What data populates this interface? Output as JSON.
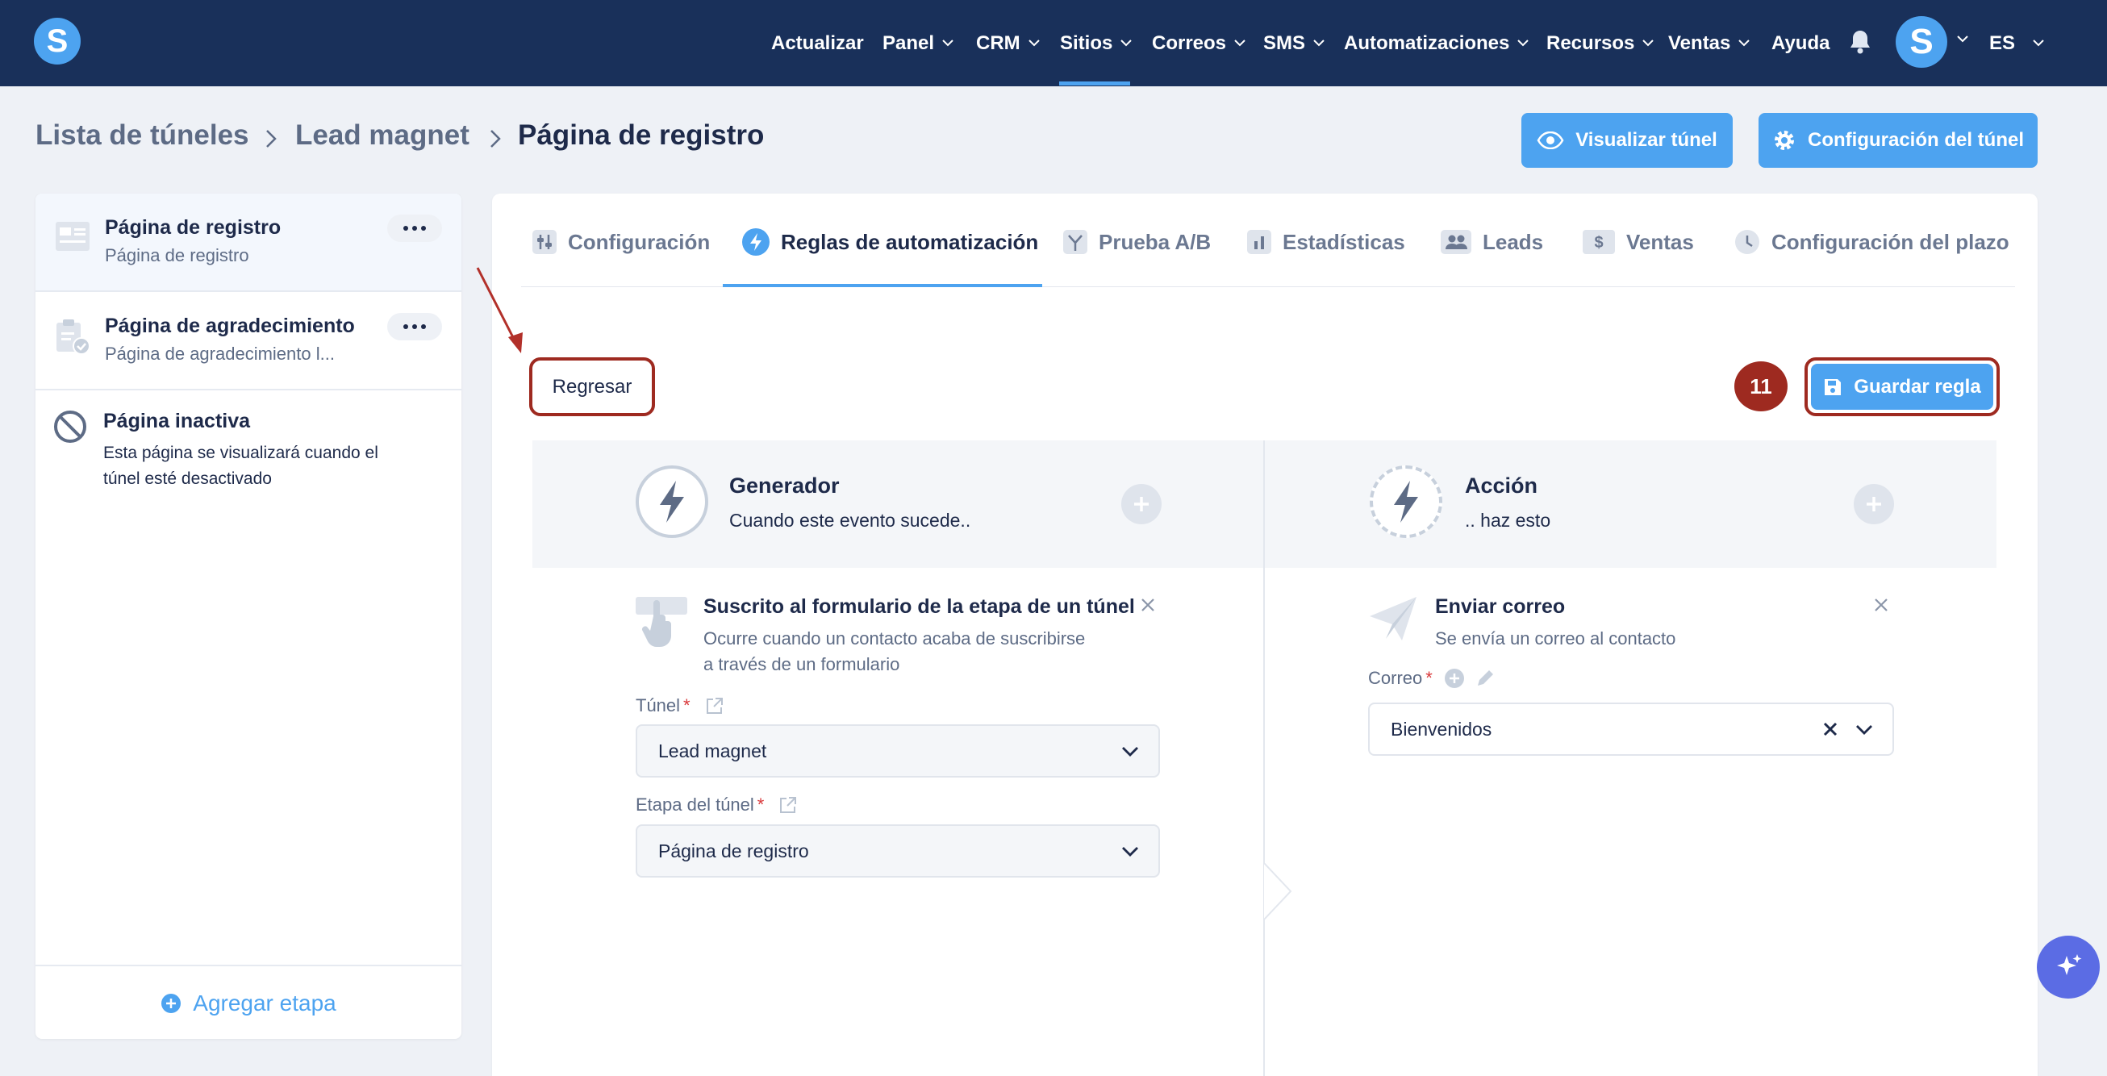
{
  "nav": {
    "logo_letter": "S",
    "items": [
      {
        "label": "Actualizar"
      },
      {
        "label": "Panel"
      },
      {
        "label": "CRM"
      },
      {
        "label": "Sitios"
      },
      {
        "label": "Correos"
      },
      {
        "label": "SMS"
      },
      {
        "label": "Automatizaciones"
      },
      {
        "label": "Recursos"
      },
      {
        "label": "Ventas"
      },
      {
        "label": "Ayuda"
      }
    ],
    "active": "Sitios",
    "avatar_letter": "S",
    "language": "ES",
    "bell_icon": "bell-icon"
  },
  "breadcrumb": [
    "Lista de túneles",
    "Lead magnet",
    "Página de registro"
  ],
  "header_buttons": {
    "preview": "Visualizar túnel",
    "settings": "Configuración del túnel"
  },
  "stages": [
    {
      "title": "Página de registro",
      "subtitle": "Página de registro",
      "icon": "form-page-icon"
    },
    {
      "title": "Página de agradecimiento",
      "subtitle": "Página de agradecimiento l...",
      "icon": "clipboard-check-icon"
    },
    {
      "title": "Página inactiva",
      "subtitle_lines": [
        "Esta página se visualizará cuando el",
        "túnel esté desactivado"
      ],
      "icon": "disabled-icon"
    }
  ],
  "add_stage_label": "Agregar etapa",
  "tabs": [
    {
      "label": "Configuración",
      "icon": "sliders-icon"
    },
    {
      "label": "Reglas de automatización",
      "icon": "bolt-icon"
    },
    {
      "label": "Prueba A/B",
      "icon": "split-icon"
    },
    {
      "label": "Estadísticas",
      "icon": "bar-chart-icon"
    },
    {
      "label": "Leads",
      "icon": "users-icon"
    },
    {
      "label": "Ventas",
      "icon": "dollar-icon"
    },
    {
      "label": "Configuración del plazo",
      "icon": "clock-icon"
    }
  ],
  "active_tab": "Reglas de automatización",
  "rule": {
    "back_label": "Regresar",
    "step_number": "11",
    "save_label": "Guardar regla",
    "trigger": {
      "heading": "Generador",
      "subheading": "Cuando este evento sucede..",
      "item_title": "Suscrito al formulario de la etapa de un túnel",
      "item_desc_lines": [
        "Ocurre cuando un contacto acaba de suscribirse",
        "a través de un formulario"
      ],
      "funnel_label": "Túnel",
      "funnel_value": "Lead magnet",
      "stage_label": "Etapa del túnel",
      "stage_value": "Página de registro"
    },
    "action": {
      "heading": "Acción",
      "subheading": ".. haz esto",
      "item_title": "Enviar correo",
      "item_desc": "Se envía un correo al contacto",
      "email_label": "Correo",
      "email_value": "Bienvenidos"
    }
  },
  "colors": {
    "nav_bg": "#19305a",
    "accent": "#4da3f0",
    "highlight_red": "#9e2a20",
    "page_bg": "#eef1f6"
  }
}
